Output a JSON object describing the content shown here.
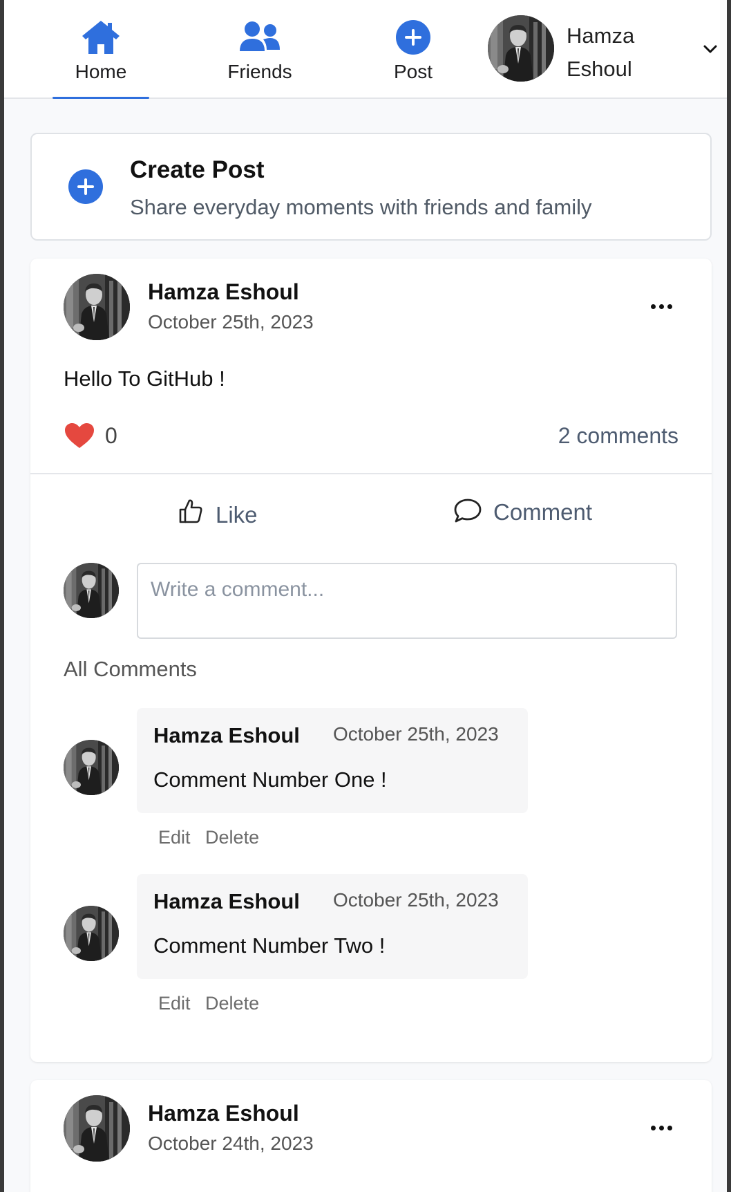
{
  "nav": {
    "items": [
      {
        "label": "Home",
        "icon": "home-icon",
        "active": true
      },
      {
        "label": "Friends",
        "icon": "friends-icon"
      },
      {
        "label": "Post",
        "icon": "plus-circle-icon"
      }
    ],
    "user": {
      "name_line1": "Hamza",
      "name_line2": "Eshoul",
      "icon": "chevron-down-icon"
    }
  },
  "create_post": {
    "title": "Create Post",
    "subtitle": "Share everyday moments with friends and family",
    "icon": "plus-circle-icon"
  },
  "posts": [
    {
      "author": "Hamza Eshoul",
      "date": "October 25th, 2023",
      "text": "Hello To GitHub !",
      "likes": "0",
      "comments_count": "2 comments",
      "actions": {
        "like": "Like",
        "comment": "Comment"
      },
      "comment_placeholder": "Write a comment...",
      "all_comments_label": "All Comments",
      "comments": [
        {
          "author": "Hamza Eshoul",
          "date": "October 25th, 2023",
          "text": "Comment Number One !",
          "edit": "Edit",
          "delete": "Delete"
        },
        {
          "author": "Hamza Eshoul",
          "date": "October 25th, 2023",
          "text": "Comment Number Two !",
          "edit": "Edit",
          "delete": "Delete"
        }
      ]
    },
    {
      "author": "Hamza Eshoul",
      "date": "October 24th, 2023"
    }
  ],
  "colors": {
    "accent": "#2f6fdd",
    "heart": "#e5483f",
    "muted_text": "#4d5b70"
  }
}
